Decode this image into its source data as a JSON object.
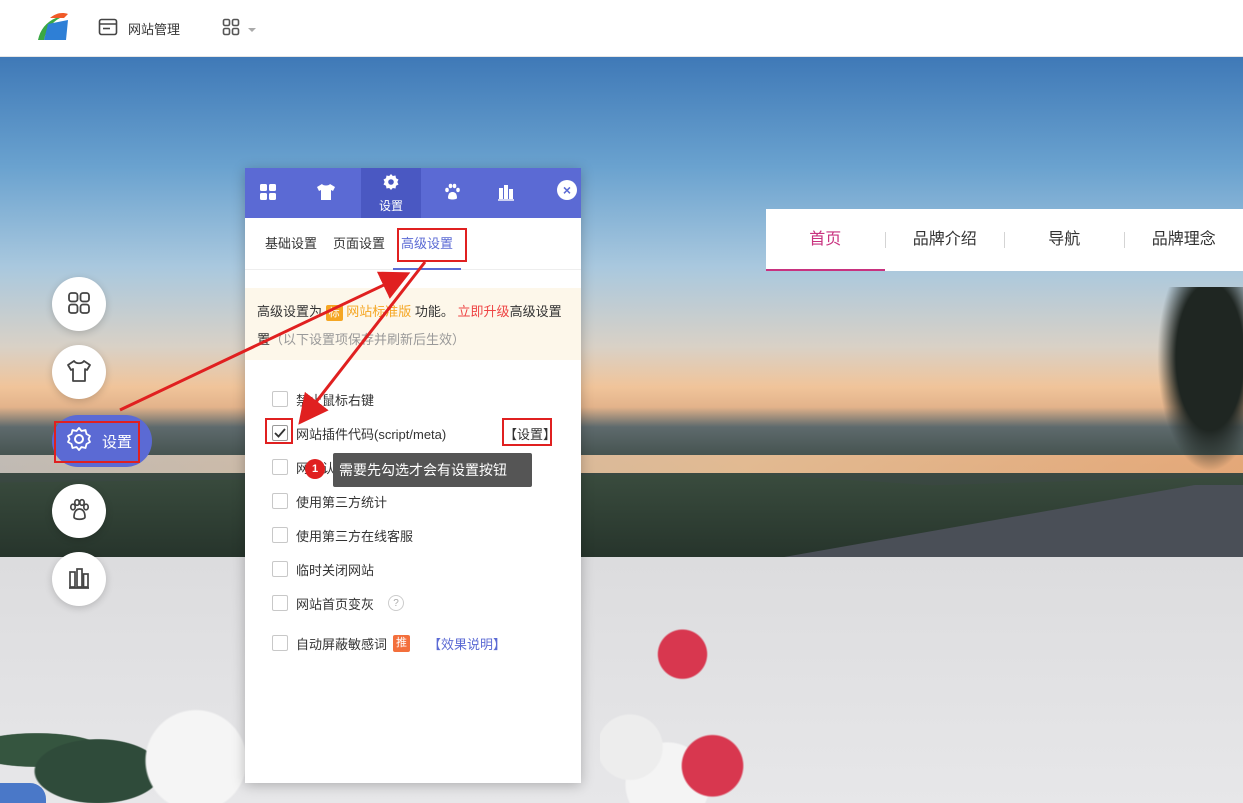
{
  "topbar": {
    "logo_icon": "brand-logo-icon",
    "site_management_label": "网站管理",
    "site_management_icon": "window-icon",
    "apps_icon": "grid-icon"
  },
  "site_nav": {
    "items": [
      "首页",
      "品牌介绍",
      "导航",
      "品牌理念"
    ],
    "active_color": "#c8327f"
  },
  "left_tools": {
    "items": [
      "grid-icon",
      "shirt-icon",
      "gear-icon",
      "paw-icon",
      "books-icon"
    ],
    "settings_label": "设置",
    "accent": "#5b6ad4"
  },
  "panel": {
    "tabs": [
      "grid-icon",
      "shirt-icon",
      "gear-icon",
      "paw-icon",
      "books-icon"
    ],
    "active_tab_label": "设置",
    "close_icon": "×",
    "subtabs": [
      "基础设置",
      "页面设置",
      "高级设置"
    ],
    "notice": {
      "prefix": "高级设置为",
      "badge": "标",
      "version": "网站标准版",
      "mid": "功能。",
      "upgrade": "立即升级",
      "suffix": "高级设置",
      "note": "（以下设置项保存并刷新后生效）"
    },
    "options": [
      {
        "label": "禁止鼠标右键",
        "checked": false
      },
      {
        "label": "网站插件代码(script/meta)",
        "checked": true,
        "action": "【设置】"
      },
      {
        "label": "网站认证",
        "checked": false
      },
      {
        "label": "使用第三方统计",
        "checked": false
      },
      {
        "label": "使用第三方在线客服",
        "checked": false
      },
      {
        "label": "临时关闭网站",
        "checked": false
      },
      {
        "label": "网站首页变灰",
        "checked": false,
        "help": "?"
      },
      {
        "label": "自动屏蔽敏感词",
        "checked": false,
        "tag": "推",
        "link": "【效果说明】"
      }
    ]
  },
  "annotation": {
    "step": "1",
    "tooltip": "需要先勾选才会有设置按钮"
  }
}
